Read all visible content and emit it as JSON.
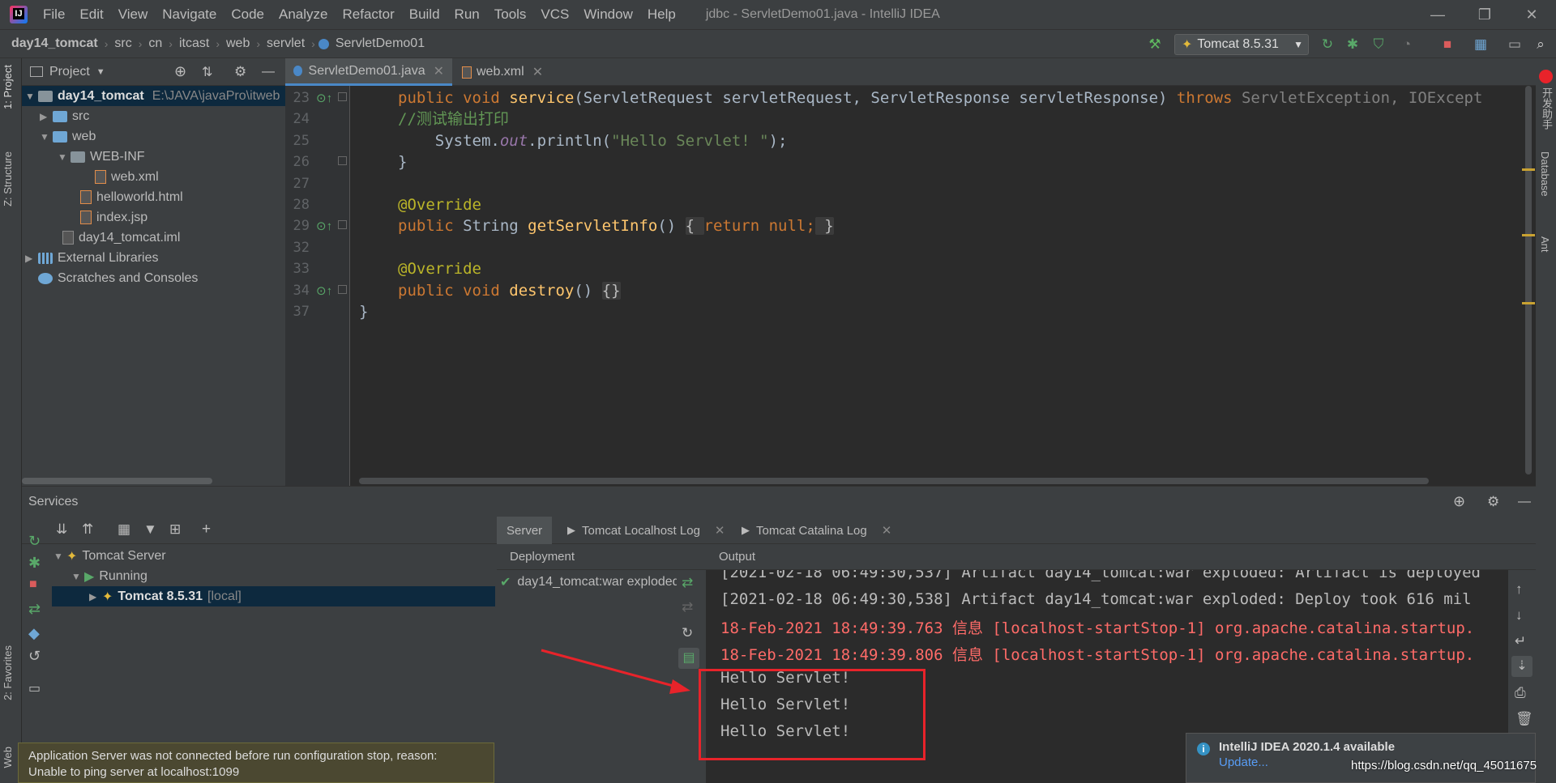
{
  "window": {
    "title": "jdbc - ServletDemo01.java - IntelliJ IDEA",
    "menu": [
      "File",
      "Edit",
      "View",
      "Navigate",
      "Code",
      "Analyze",
      "Refactor",
      "Build",
      "Run",
      "Tools",
      "VCS",
      "Window",
      "Help"
    ]
  },
  "breadcrumb": [
    "day14_tomcat",
    "src",
    "cn",
    "itcast",
    "web",
    "servlet",
    "ServletDemo01"
  ],
  "run_config": "Tomcat 8.5.31",
  "left_tabs": {
    "project": "1: Project",
    "structure": "Z: Structure",
    "favorites": "2: Favorites",
    "web": "Web"
  },
  "right_tabs": {
    "helper": "开发助手",
    "database": "Database",
    "ant": "Ant"
  },
  "project": {
    "title": "Project",
    "items": [
      {
        "label": "day14_tomcat",
        "note": "E:\\JAVA\\javaPro\\itweb"
      },
      {
        "label": "src"
      },
      {
        "label": "web"
      },
      {
        "label": "WEB-INF"
      },
      {
        "label": "web.xml"
      },
      {
        "label": "helloworld.html"
      },
      {
        "label": "index.jsp"
      },
      {
        "label": "day14_tomcat.iml"
      },
      {
        "label": "External Libraries"
      },
      {
        "label": "Scratches and Consoles"
      }
    ]
  },
  "editor": {
    "tabs": [
      "ServletDemo01.java",
      "web.xml"
    ],
    "lines": [
      {
        "n": "23",
        "parts": [
          [
            "kw",
            "public "
          ],
          [
            "kw",
            "void "
          ],
          [
            "fn",
            "service"
          ],
          [
            "ty",
            "(ServletRequest servletRequest, ServletResponse servletResponse) "
          ],
          [
            "kw",
            "throws "
          ],
          [
            "gr",
            "ServletException, IOExcept"
          ]
        ]
      },
      {
        "n": "24",
        "parts": [
          [
            "cm",
            "//测试输出打印"
          ]
        ]
      },
      {
        "n": "25",
        "parts": [
          [
            "ty",
            "    System."
          ],
          [
            "it",
            "out"
          ],
          [
            "ty",
            ".println("
          ],
          [
            "str",
            "\"Hello Servlet! \""
          ],
          [
            "ty",
            ");"
          ]
        ]
      },
      {
        "n": "26",
        "parts": [
          [
            "ty",
            "}"
          ]
        ]
      },
      {
        "n": "27",
        "parts": []
      },
      {
        "n": "28",
        "parts": [
          [
            "ann",
            "@Override"
          ]
        ]
      },
      {
        "n": "29",
        "parts": [
          [
            "kw",
            "public "
          ],
          [
            "ty",
            "String "
          ],
          [
            "fn",
            "getServletInfo"
          ],
          [
            "ty",
            "() "
          ],
          [
            "fold",
            "{ "
          ],
          [
            "kw",
            "return "
          ],
          [
            "kw",
            "null"
          ],
          [
            "kw",
            ";"
          ],
          [
            "fold",
            " }"
          ]
        ]
      },
      {
        "n": "32",
        "parts": []
      },
      {
        "n": "33",
        "parts": [
          [
            "ann",
            "@Override"
          ]
        ]
      },
      {
        "n": "34",
        "parts": [
          [
            "kw",
            "public "
          ],
          [
            "kw",
            "void "
          ],
          [
            "fn",
            "destroy"
          ],
          [
            "ty",
            "() "
          ],
          [
            "fold",
            "{}"
          ]
        ]
      },
      {
        "n": "37",
        "parts": [
          [
            "ty",
            "}"
          ]
        ]
      }
    ]
  },
  "services": {
    "title": "Services",
    "tree": [
      "Tomcat Server",
      "Running",
      "Tomcat 8.5.31",
      "[local]"
    ],
    "tabs": [
      "Server",
      "Tomcat Localhost Log",
      "Tomcat Catalina Log"
    ],
    "deployment_header": "Deployment",
    "deployment_item": "day14_tomcat:war exploded",
    "output_header": "Output",
    "output_lines": [
      {
        "c": "",
        "t": "[2021-02-18 06:49:30,537] Artifact day14_tomcat:war exploded: Artifact is deployed"
      },
      {
        "c": "",
        "t": "[2021-02-18 06:49:30,538] Artifact day14_tomcat:war exploded: Deploy took 616 mil"
      },
      {
        "c": "red",
        "t": "18-Feb-2021 18:49:39.763 信息 [localhost-startStop-1] org.apache.catalina.startup."
      },
      {
        "c": "red",
        "t": "18-Feb-2021 18:49:39.806 信息 [localhost-startStop-1] org.apache.catalina.startup."
      },
      {
        "c": "",
        "t": "Hello Servlet!"
      },
      {
        "c": "",
        "t": "Hello Servlet!"
      },
      {
        "c": "",
        "t": "Hello Servlet!"
      }
    ]
  },
  "notifications": {
    "error_line1": "Application Server was not connected before run configuration stop, reason:",
    "error_line2": "Unable to ping server at localhost:1099",
    "update_title": "IntelliJ IDEA 2020.1.4 available",
    "update_link": "Update..."
  },
  "watermark": "https://blog.csdn.net/qq_45011675",
  "colors": {
    "accent": "#4a88c7",
    "highlight": "#e8232a",
    "error": "#ff6b68"
  }
}
